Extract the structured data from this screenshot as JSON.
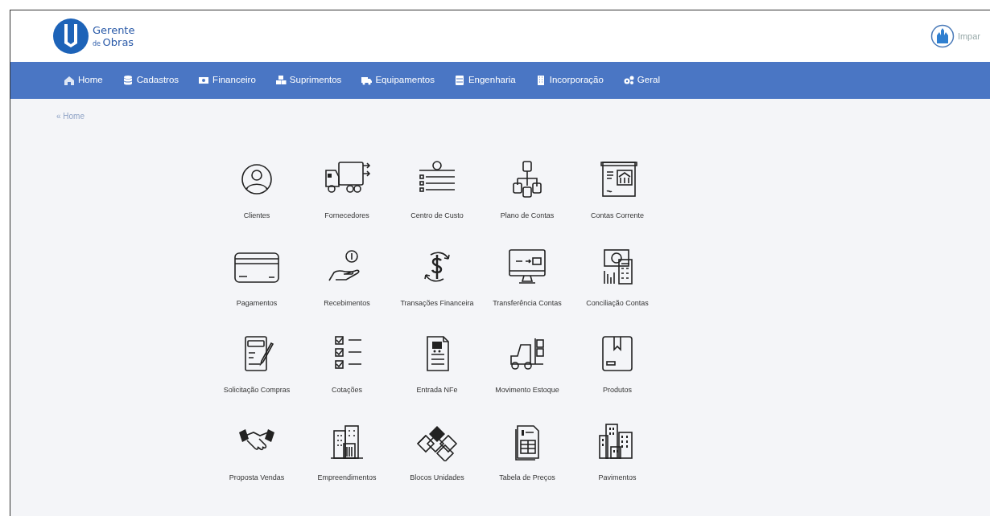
{
  "header": {
    "logo": {
      "line1": "Gerente",
      "prefix": "de",
      "line2": "Obras"
    },
    "user": {
      "name": "Impar"
    }
  },
  "nav": [
    {
      "label": "Home"
    },
    {
      "label": "Cadastros"
    },
    {
      "label": "Financeiro"
    },
    {
      "label": "Suprimentos"
    },
    {
      "label": "Equipamentos"
    },
    {
      "label": "Engenharia"
    },
    {
      "label": "Incorporação"
    },
    {
      "label": "Geral"
    }
  ],
  "breadcrumb": "« Home",
  "tiles": [
    {
      "label": "Clientes"
    },
    {
      "label": "Fornecedores"
    },
    {
      "label": "Centro de Custo"
    },
    {
      "label": "Plano de Contas"
    },
    {
      "label": "Contas Corrente"
    },
    {
      "label": "Pagamentos"
    },
    {
      "label": "Recebimentos"
    },
    {
      "label": "Transações Financeira"
    },
    {
      "label": "Transferência Contas"
    },
    {
      "label": "Conciliação Contas"
    },
    {
      "label": "Solicitação Compras"
    },
    {
      "label": "Cotações"
    },
    {
      "label": "Entrada NFe"
    },
    {
      "label": "Movimento Estoque"
    },
    {
      "label": "Produtos"
    },
    {
      "label": "Proposta Vendas"
    },
    {
      "label": "Empreendimentos"
    },
    {
      "label": "Blocos Unidades"
    },
    {
      "label": "Tabela de Preços"
    },
    {
      "label": "Pavimentos"
    }
  ]
}
